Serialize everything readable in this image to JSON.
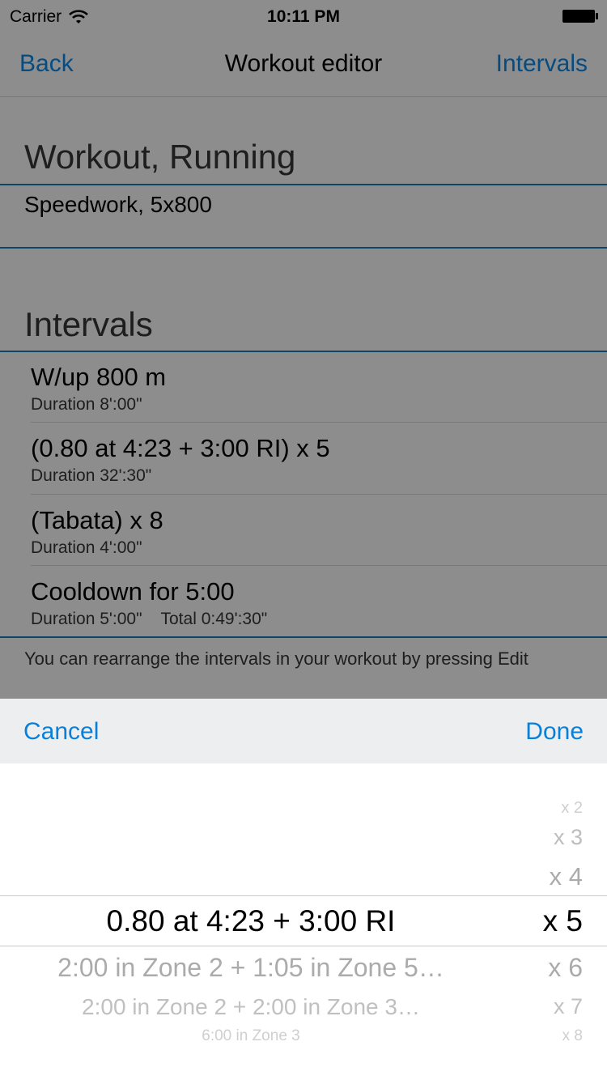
{
  "status_bar": {
    "carrier": "Carrier",
    "time": "10:11 PM"
  },
  "nav": {
    "back": "Back",
    "title": "Workout editor",
    "right": "Intervals"
  },
  "workout_section": {
    "header": "Workout, Running",
    "name": "Speedwork, 5x800"
  },
  "intervals_section": {
    "header": "Intervals",
    "items": [
      {
        "title": "W/up 800 m",
        "subtitle": "Duration 8':00\""
      },
      {
        "title": "(0.80 at 4:23 + 3:00 RI) x 5",
        "subtitle": "Duration 32':30\""
      },
      {
        "title": "(Tabata) x 8",
        "subtitle": "Duration 4':00\""
      },
      {
        "title": "Cooldown for 5:00",
        "subtitle": "Duration 5':00\"    Total 0:49':30\""
      }
    ],
    "footer": "You can rearrange the intervals in your workout by pressing Edit"
  },
  "picker_sheet": {
    "cancel": "Cancel",
    "done": "Done",
    "left_wheel": {
      "selected": "0.80 at 4:23 + 3:00 RI",
      "below": [
        "2:00  in Zone 2 + 1:05  in Zone 5…",
        "2:00  in Zone 2 + 2:00  in Zone 3…",
        "6:00  in Zone 3"
      ]
    },
    "right_wheel": {
      "above": [
        "x 2",
        "x 3",
        "x 4"
      ],
      "selected": "x 5",
      "below": [
        "x 6",
        "x 7",
        "x 8"
      ]
    }
  },
  "colors": {
    "accent": "#0a7fd8",
    "section_line": "#1976a8",
    "dim_overlay": "rgba(0,0,0,0.40)"
  }
}
